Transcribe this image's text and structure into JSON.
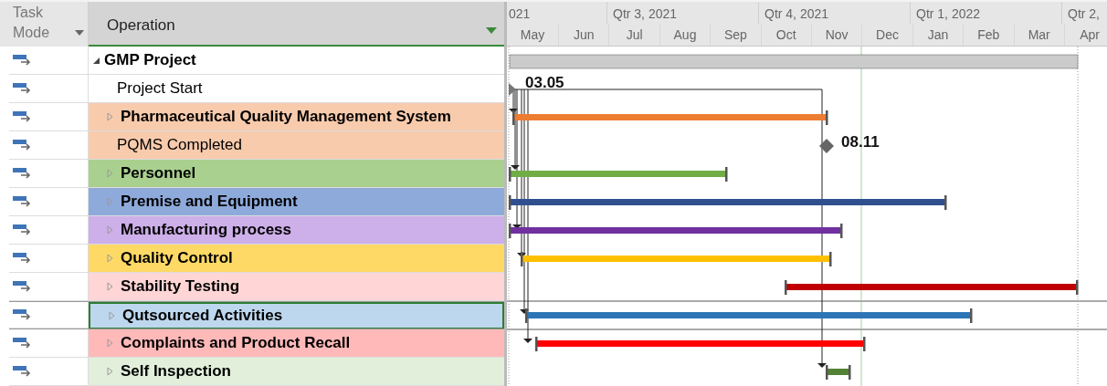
{
  "columns": [
    {
      "label": "Task Mode"
    },
    {
      "label": "Operation"
    }
  ],
  "timeline": {
    "quarters": [
      "021",
      "Qtr 3, 2021",
      "Qtr 4, 2021",
      "Qtr 1, 2022",
      "Qtr 2,"
    ],
    "months": [
      "May",
      "Jun",
      "Jul",
      "Aug",
      "Sep",
      "Oct",
      "Nov",
      "Dec",
      "Jan",
      "Feb",
      "Mar",
      "Apr"
    ]
  },
  "rows": [
    {
      "name": "GMP Project",
      "kind": "summary",
      "expanded": true,
      "selected": false
    },
    {
      "name": "Project Start",
      "kind": "milestone",
      "selected": false,
      "milestone_label": "03.05"
    },
    {
      "name": "Pharmaceutical Quality Management System",
      "kind": "group",
      "expanded": false,
      "selected": false,
      "color": "#f8cbad",
      "bar": {
        "color": "#ed7d31"
      }
    },
    {
      "name": "PQMS Completed",
      "kind": "milestone",
      "selected": false,
      "color": "#f8cbad",
      "milestone_label": "08.11"
    },
    {
      "name": "Personnel",
      "kind": "group",
      "expanded": false,
      "selected": false,
      "color": "#a9d08e",
      "bar": {
        "color": "#70ad47"
      }
    },
    {
      "name": "Premise and Equipment",
      "kind": "group",
      "expanded": false,
      "selected": false,
      "color": "#8eaadb",
      "bar": {
        "color": "#2f4f8f"
      }
    },
    {
      "name": "Manufacturing process",
      "kind": "group",
      "expanded": false,
      "selected": false,
      "color": "#cdafe9",
      "bar": {
        "color": "#7030a0"
      }
    },
    {
      "name": "Quality Control",
      "kind": "group",
      "expanded": false,
      "selected": false,
      "color": "#ffd966",
      "bar": {
        "color": "#ffc000"
      }
    },
    {
      "name": "Stability Testing",
      "kind": "group",
      "expanded": false,
      "selected": false,
      "color": "#ffd5d5",
      "bar": {
        "color": "#c00000"
      }
    },
    {
      "name": "Qutsourced Activities",
      "kind": "group",
      "expanded": false,
      "selected": true,
      "color": "#bdd7ee",
      "bar": {
        "color": "#2e75b6"
      }
    },
    {
      "name": "Complaints and Product Recall",
      "kind": "group",
      "expanded": false,
      "selected": false,
      "color": "#ffb9b9",
      "bar": {
        "color": "#ff0000"
      }
    },
    {
      "name": "Self Inspection",
      "kind": "group",
      "expanded": false,
      "selected": false,
      "color": "#e2efda",
      "bar": {
        "color": "#548235"
      }
    }
  ]
}
